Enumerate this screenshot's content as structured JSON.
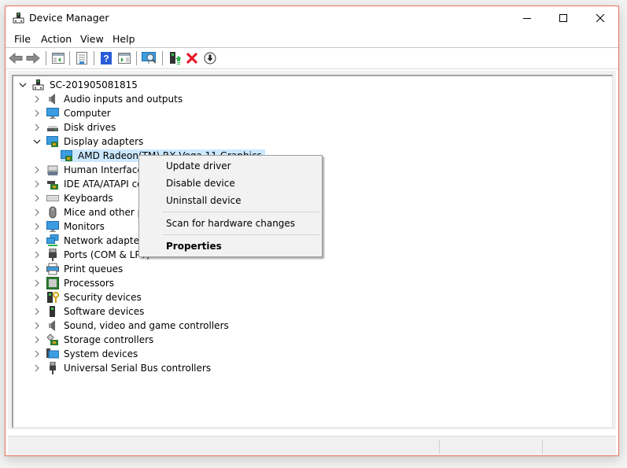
{
  "window": {
    "title": "Device Manager",
    "controls": {
      "minimize": "minimize",
      "maximize": "maximize",
      "close": "close"
    }
  },
  "menubar": [
    "File",
    "Action",
    "View",
    "Help"
  ],
  "toolbar": [
    {
      "icon": "back-arrow-icon",
      "name": "back-button"
    },
    {
      "icon": "forward-arrow-icon",
      "name": "forward-button"
    },
    {
      "icon": "show-hide-console-tree-icon",
      "name": "show-hide-console-tree-button"
    },
    {
      "icon": "properties-icon",
      "name": "properties-button"
    },
    {
      "icon": "help-icon",
      "name": "help-button"
    },
    {
      "icon": "show-action-pane-icon",
      "name": "show-action-pane-button"
    },
    {
      "icon": "scan-hardware-icon",
      "name": "scan-hardware-button"
    },
    {
      "icon": "update-driver-icon",
      "name": "update-driver-button"
    },
    {
      "icon": "uninstall-device-icon",
      "name": "uninstall-device-button"
    },
    {
      "icon": "disable-device-icon",
      "name": "disable-device-button"
    }
  ],
  "tree": {
    "root": "SC-201905081815",
    "categories": [
      {
        "label": "Audio inputs and outputs",
        "icon": "speaker-icon",
        "expanded": false
      },
      {
        "label": "Computer",
        "icon": "computer-icon",
        "expanded": false
      },
      {
        "label": "Disk drives",
        "icon": "disk-drive-icon",
        "expanded": false
      },
      {
        "label": "Display adapters",
        "icon": "display-adapter-icon",
        "expanded": true,
        "children": [
          {
            "label": "AMD Radeon(TM) RX Vega 11 Graphics",
            "icon": "display-adapter-icon",
            "selected": true
          }
        ]
      },
      {
        "label": "Human Interface Devices",
        "icon": "hid-icon",
        "expanded": false
      },
      {
        "label": "IDE ATA/ATAPI controllers",
        "icon": "ide-controller-icon",
        "expanded": false
      },
      {
        "label": "Keyboards",
        "icon": "keyboard-icon",
        "expanded": false
      },
      {
        "label": "Mice and other pointing devices",
        "icon": "mouse-icon",
        "expanded": false
      },
      {
        "label": "Monitors",
        "icon": "monitor-icon",
        "expanded": false
      },
      {
        "label": "Network adapters",
        "icon": "network-adapter-icon",
        "expanded": false
      },
      {
        "label": "Ports (COM & LPT)",
        "icon": "port-icon",
        "expanded": false
      },
      {
        "label": "Print queues",
        "icon": "printer-icon",
        "expanded": false
      },
      {
        "label": "Processors",
        "icon": "processor-icon",
        "expanded": false
      },
      {
        "label": "Security devices",
        "icon": "security-device-icon",
        "expanded": false
      },
      {
        "label": "Software devices",
        "icon": "software-device-icon",
        "expanded": false
      },
      {
        "label": "Sound, video and game controllers",
        "icon": "speaker-icon",
        "expanded": false
      },
      {
        "label": "Storage controllers",
        "icon": "storage-controller-icon",
        "expanded": false
      },
      {
        "label": "System devices",
        "icon": "system-device-icon",
        "expanded": false
      },
      {
        "label": "Universal Serial Bus controllers",
        "icon": "usb-icon",
        "expanded": false
      }
    ]
  },
  "context_menu": {
    "items": [
      {
        "label": "Update driver",
        "bold": false
      },
      {
        "label": "Disable device",
        "bold": false
      },
      {
        "label": "Uninstall device",
        "bold": false
      },
      {
        "separator": true
      },
      {
        "label": "Scan for hardware changes",
        "bold": false
      },
      {
        "separator": true
      },
      {
        "label": "Properties",
        "bold": true
      }
    ]
  },
  "colors": {
    "window_border": "#e8735a",
    "selection": "#cce8ff",
    "uninstall_red": "#e81123",
    "update_green": "#2db34a",
    "help_blue": "#2a5bd7"
  }
}
